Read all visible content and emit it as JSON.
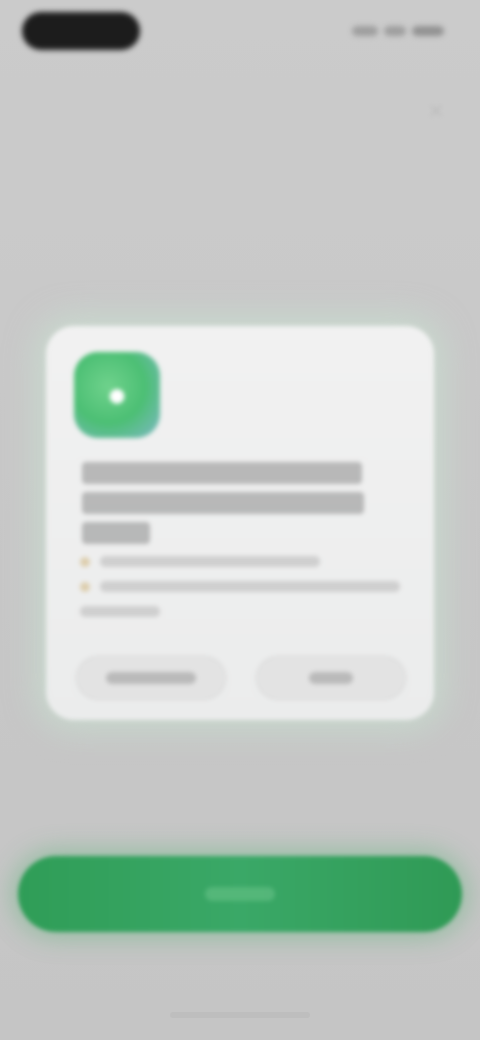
{
  "status_bar": {
    "time": "",
    "signal_icon": "signal-icon",
    "wifi_icon": "wifi-icon",
    "battery_icon": "battery-icon"
  },
  "header": {
    "close_icon": "close-icon"
  },
  "dialog": {
    "app_icon": "app-icon",
    "title": "",
    "description": "",
    "secondary_button_label": "",
    "primary_dialog_button_label": ""
  },
  "primary_button": {
    "label": ""
  },
  "colors": {
    "accent_green": "#2f9d57",
    "dialog_background": "#eeeeee",
    "screen_background": "#c9c9c9"
  }
}
